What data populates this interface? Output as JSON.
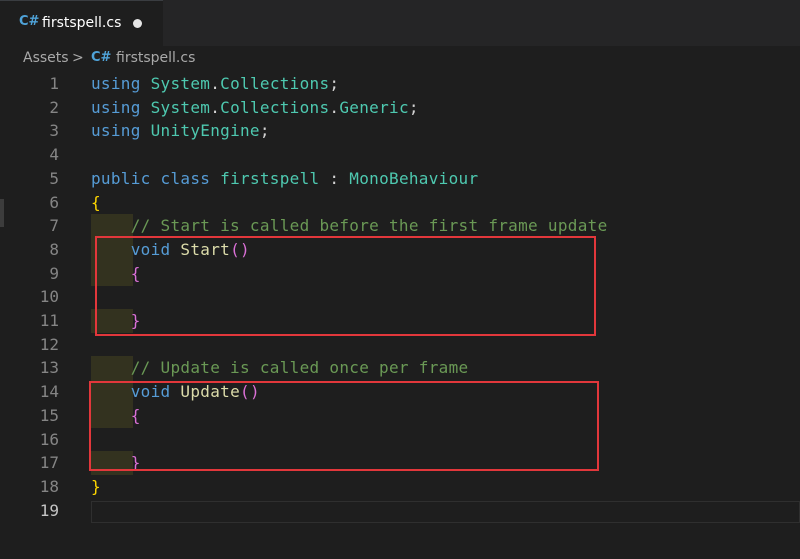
{
  "tab": {
    "icon": "C#",
    "label": "firstspell.cs",
    "dirty": true
  },
  "breadcrumb": {
    "folder": "Assets",
    "separator": ">",
    "icon": "C#",
    "file": "firstspell.cs"
  },
  "editor": {
    "active_line": 19,
    "line_numbers": [
      "1",
      "2",
      "3",
      "4",
      "5",
      "6",
      "7",
      "8",
      "9",
      "10",
      "11",
      "12",
      "13",
      "14",
      "15",
      "16",
      "17",
      "18",
      "19"
    ],
    "lines": [
      [
        {
          "t": "using ",
          "c": "kw"
        },
        {
          "t": "System",
          "c": "ns"
        },
        {
          "t": ".",
          "c": "pl"
        },
        {
          "t": "Collections",
          "c": "ns"
        },
        {
          "t": ";",
          "c": "pl"
        }
      ],
      [
        {
          "t": "using ",
          "c": "kw"
        },
        {
          "t": "System",
          "c": "ns"
        },
        {
          "t": ".",
          "c": "pl"
        },
        {
          "t": "Collections",
          "c": "ns"
        },
        {
          "t": ".",
          "c": "pl"
        },
        {
          "t": "Generic",
          "c": "ns"
        },
        {
          "t": ";",
          "c": "pl"
        }
      ],
      [
        {
          "t": "using ",
          "c": "kw"
        },
        {
          "t": "UnityEngine",
          "c": "ns"
        },
        {
          "t": ";",
          "c": "pl"
        }
      ],
      [],
      [
        {
          "t": "public ",
          "c": "kw"
        },
        {
          "t": "class ",
          "c": "kw"
        },
        {
          "t": "firstspell",
          "c": "ty"
        },
        {
          "t": " : ",
          "c": "pl"
        },
        {
          "t": "MonoBehaviour",
          "c": "ty"
        }
      ],
      [
        {
          "t": "{",
          "c": "b1"
        }
      ],
      [
        {
          "t": "    ",
          "c": "pl"
        },
        {
          "t": "// Start is called before the first frame update",
          "c": "cm"
        }
      ],
      [
        {
          "t": "    ",
          "c": "pl"
        },
        {
          "t": "void ",
          "c": "kw"
        },
        {
          "t": "Start",
          "c": "fn"
        },
        {
          "t": "()",
          "c": "b2"
        }
      ],
      [
        {
          "t": "    ",
          "c": "pl"
        },
        {
          "t": "{",
          "c": "b2"
        }
      ],
      [],
      [
        {
          "t": "    ",
          "c": "pl"
        },
        {
          "t": "}",
          "c": "b2"
        }
      ],
      [],
      [
        {
          "t": "    ",
          "c": "pl"
        },
        {
          "t": "// Update is called once per frame",
          "c": "cm"
        }
      ],
      [
        {
          "t": "    ",
          "c": "pl"
        },
        {
          "t": "void ",
          "c": "kw"
        },
        {
          "t": "Update",
          "c": "fn"
        },
        {
          "t": "()",
          "c": "b2"
        }
      ],
      [
        {
          "t": "    ",
          "c": "pl"
        },
        {
          "t": "{",
          "c": "b2"
        }
      ],
      [],
      [
        {
          "t": "    ",
          "c": "pl"
        },
        {
          "t": "}",
          "c": "b2"
        }
      ],
      [
        {
          "t": "}",
          "c": "b1"
        }
      ],
      []
    ]
  },
  "colors": {
    "background": "#1e1e1e",
    "keyword": "#569cd6",
    "type": "#4ec9b0",
    "function": "#dcdcaa",
    "comment": "#6a9955",
    "bracket_outer": "#ffd700",
    "bracket_inner": "#da70d6",
    "highlight_box": "#e2373b"
  },
  "icons": {
    "tab_icon": "csharp-file-icon",
    "breadcrumb_icon": "csharp-file-icon",
    "dirty_indicator": "unsaved-dot-icon"
  }
}
